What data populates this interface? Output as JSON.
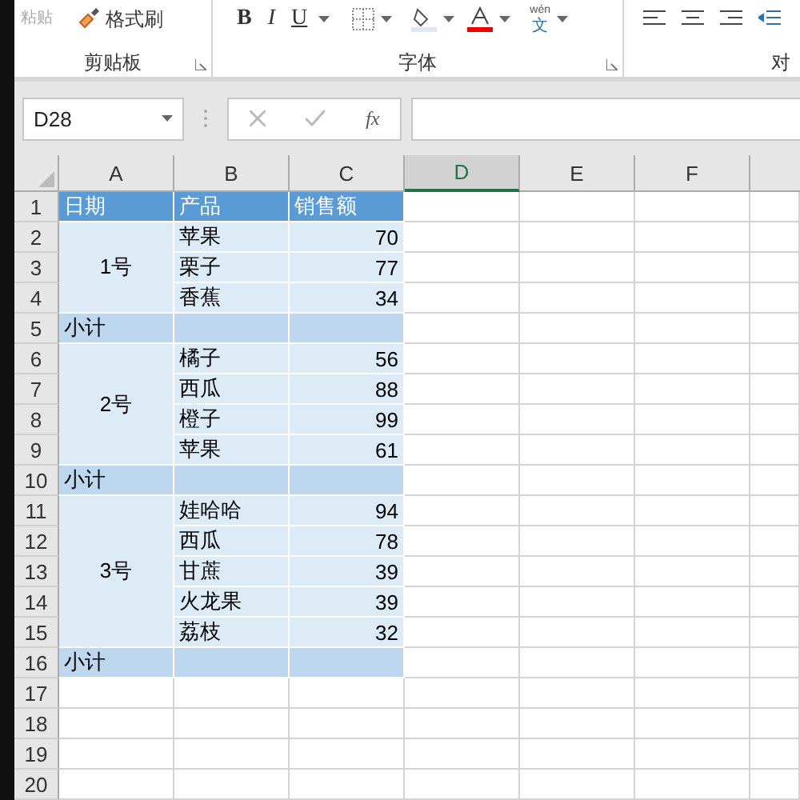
{
  "ribbon": {
    "paste_label": "粘贴",
    "format_painter": "格式刷",
    "groups": [
      {
        "label": "剪贴板"
      },
      {
        "label": "字体"
      },
      {
        "label": "对"
      }
    ],
    "font_buttons": [
      {
        "label": "B",
        "kind": "bold"
      },
      {
        "label": "I",
        "kind": "italic"
      },
      {
        "label": "U",
        "kind": "underline"
      }
    ],
    "phonetic": {
      "top": "wén",
      "bottom": "文"
    }
  },
  "formula_bar": {
    "name_box": "D28",
    "function_label": "fx"
  },
  "sheet": {
    "columns": [
      {
        "label": "A",
        "selected": false
      },
      {
        "label": "B",
        "selected": false
      },
      {
        "label": "C",
        "selected": false
      },
      {
        "label": "D",
        "selected": true
      },
      {
        "label": "E",
        "selected": false
      },
      {
        "label": "F",
        "selected": false
      }
    ],
    "row_numbers": [
      "1",
      "2",
      "3",
      "4",
      "5",
      "6",
      "7",
      "8",
      "9",
      "10",
      "11",
      "12",
      "13",
      "14",
      "15",
      "16",
      "17",
      "18",
      "19",
      "20"
    ],
    "header": [
      "日期",
      "产品",
      "销售额"
    ],
    "groups": [
      {
        "date": "1号",
        "subtotal": "小计",
        "items": [
          {
            "product": "苹果",
            "sales": "70"
          },
          {
            "product": "栗子",
            "sales": "77"
          },
          {
            "product": "香蕉",
            "sales": "34"
          }
        ]
      },
      {
        "date": "2号",
        "subtotal": "小计",
        "items": [
          {
            "product": "橘子",
            "sales": "56"
          },
          {
            "product": "西瓜",
            "sales": "88"
          },
          {
            "product": "橙子",
            "sales": "99"
          },
          {
            "product": "苹果",
            "sales": "61"
          }
        ]
      },
      {
        "date": "3号",
        "subtotal": "小计",
        "items": [
          {
            "product": "娃哈哈",
            "sales": "94"
          },
          {
            "product": "西瓜",
            "sales": "78"
          },
          {
            "product": "甘蔗",
            "sales": "39"
          },
          {
            "product": "火龙果",
            "sales": "39"
          },
          {
            "product": "荔枝",
            "sales": "32"
          }
        ]
      }
    ]
  }
}
